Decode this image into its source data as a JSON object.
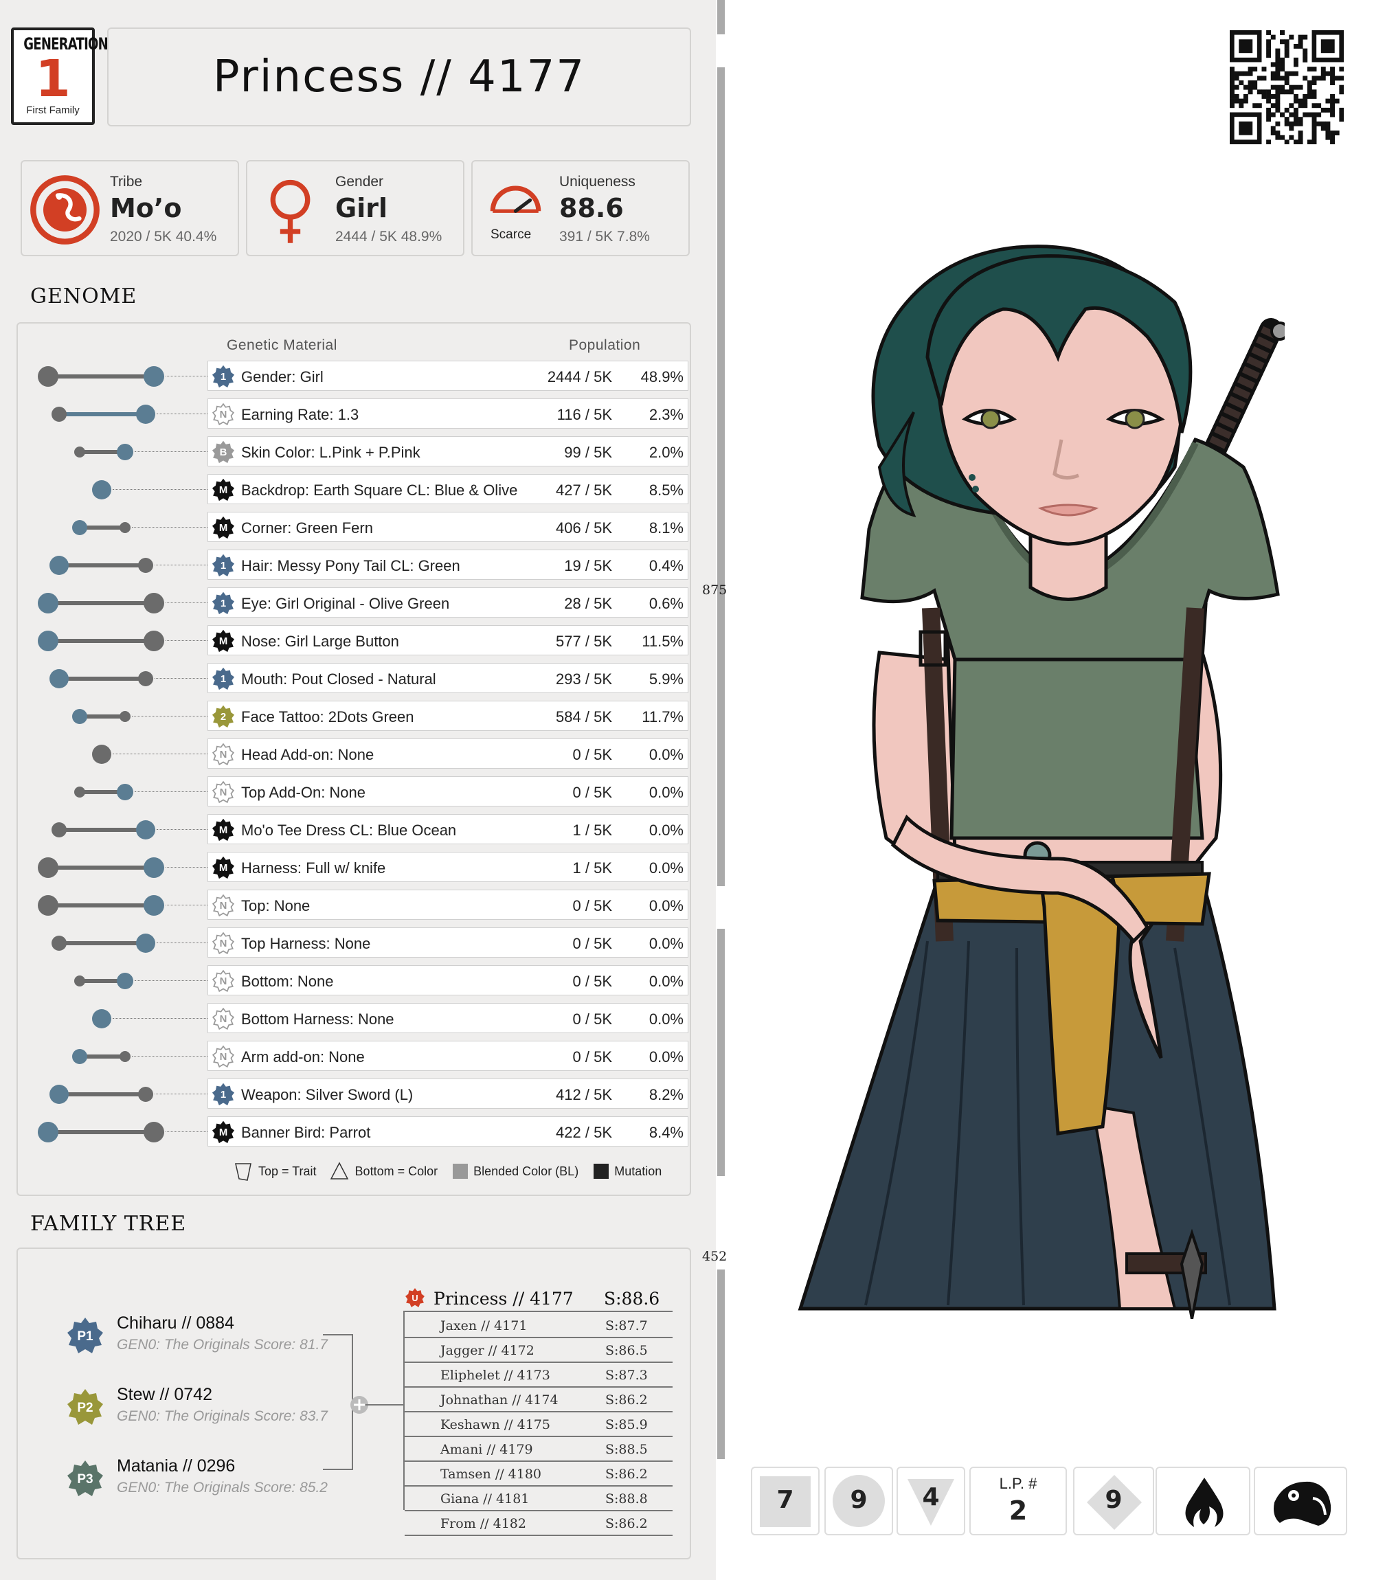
{
  "header": {
    "generation_label": "GENERATION",
    "generation_number": "1",
    "generation_sub": "First Family",
    "title": "Princess // 4177"
  },
  "stats": [
    {
      "label": "Tribe",
      "value": "Mo’o",
      "count": "2020 / 5K  40.4%",
      "icon": "lizard-icon"
    },
    {
      "label": "Gender",
      "value": "Girl",
      "count": "2444 / 5K  48.9%",
      "icon": "female-icon"
    },
    {
      "label": "Uniqueness",
      "value": "88.6",
      "count": "391 / 5K  7.8%",
      "icon": "gauge-icon",
      "icon_caption": "Scarce"
    }
  ],
  "side_numbers": [
    "875",
    "452"
  ],
  "genome": {
    "title": "GENOME",
    "col_material": "Genetic Material",
    "col_population": "Population",
    "rows": [
      {
        "badge": "1",
        "name": "Gender: Girl",
        "pop": "2444 / 5K",
        "pct": "48.9%"
      },
      {
        "badge": "N",
        "name": "Earning Rate: 1.3",
        "pop": "116 / 5K",
        "pct": "2.3%"
      },
      {
        "badge": "B",
        "name": "Skin Color: L.Pink + P.Pink",
        "pop": "99 / 5K",
        "pct": "2.0%"
      },
      {
        "badge": "M",
        "name": "Backdrop: Earth Square CL: Blue & Olive",
        "pop": "427 / 5K",
        "pct": "8.5%"
      },
      {
        "badge": "M",
        "name": "Corner: Green Fern",
        "pop": "406 / 5K",
        "pct": "8.1%"
      },
      {
        "badge": "1",
        "name": "Hair: Messy Pony Tail CL: Green",
        "pop": "19 / 5K",
        "pct": "0.4%"
      },
      {
        "badge": "1",
        "name": "Eye: Girl Original - Olive Green",
        "pop": "28 / 5K",
        "pct": "0.6%"
      },
      {
        "badge": "M",
        "name": "Nose: Girl Large Button",
        "pop": "577 / 5K",
        "pct": "11.5%"
      },
      {
        "badge": "1",
        "name": "Mouth: Pout Closed - Natural",
        "pop": "293 / 5K",
        "pct": "5.9%"
      },
      {
        "badge": "2",
        "name": "Face Tattoo: 2Dots Green",
        "pop": "584 / 5K",
        "pct": "11.7%"
      },
      {
        "badge": "N",
        "name": "Head Add-on:  None",
        "pop": "0 / 5K",
        "pct": "0.0%"
      },
      {
        "badge": "N",
        "name": "Top Add-On:  None",
        "pop": "0 / 5K",
        "pct": "0.0%"
      },
      {
        "badge": "M",
        "name": "Mo'o Tee Dress CL: Blue Ocean",
        "pop": "1 / 5K",
        "pct": "0.0%"
      },
      {
        "badge": "M",
        "name": "Harness: Full w/ knife",
        "pop": "1 / 5K",
        "pct": "0.0%"
      },
      {
        "badge": "N",
        "name": "Top: None",
        "pop": "0 / 5K",
        "pct": "0.0%"
      },
      {
        "badge": "N",
        "name": "Top Harness: None",
        "pop": "0 / 5K",
        "pct": "0.0%"
      },
      {
        "badge": "N",
        "name": "Bottom: None",
        "pop": "0 / 5K",
        "pct": "0.0%"
      },
      {
        "badge": "N",
        "name": "Bottom Harness: None",
        "pop": "0 / 5K",
        "pct": "0.0%"
      },
      {
        "badge": "N",
        "name": "Arm add-on: None",
        "pop": "0 / 5K",
        "pct": "0.0%"
      },
      {
        "badge": "1",
        "name": "Weapon: Silver Sword (L)",
        "pop": "412 / 5K",
        "pct": "8.2%"
      },
      {
        "badge": "M",
        "name": "Banner Bird:  Parrot",
        "pop": "422 / 5K",
        "pct": "8.4%"
      }
    ],
    "legend": {
      "trait": "Top = Trait",
      "color": "Bottom = Color",
      "blended": "Blended Color (BL)",
      "mutation": "Mutation"
    }
  },
  "family": {
    "title": "FAMILY TREE",
    "parents": [
      {
        "badge": "P1",
        "name": "Chiharu  //  0884",
        "score": "GEN0: The Originals Score: 81.7",
        "color": "#4a6a8c"
      },
      {
        "badge": "P2",
        "name": "Stew  //  0742",
        "score": "GEN0: The Originals Score: 83.7",
        "color": "#99973a"
      },
      {
        "badge": "P3",
        "name": "Matania  //  0296",
        "score": "GEN0: The Originals Score: 85.2",
        "color": "#5a7469"
      }
    ],
    "self": {
      "badge": "U",
      "name": "Princess // 4177",
      "score": "S:88.6"
    },
    "siblings": [
      {
        "name": "Jaxen  //  4171",
        "score": "S:87.7"
      },
      {
        "name": "Jagger  //  4172",
        "score": "S:86.5"
      },
      {
        "name": "Eliphelet  //  4173",
        "score": "S:87.3"
      },
      {
        "name": "Johnathan  //  4174",
        "score": "S:86.2"
      },
      {
        "name": "Keshawn  //  4175",
        "score": "S:85.9"
      },
      {
        "name": "Amani  //  4179",
        "score": "S:88.5"
      },
      {
        "name": "Tamsen  //  4180",
        "score": "S:86.2"
      },
      {
        "name": "Giana  //  4181",
        "score": "S:88.8"
      },
      {
        "name": "From  //  4182",
        "score": "S:86.2"
      }
    ]
  },
  "bottom_tiles": [
    {
      "value": "7",
      "shape": "square"
    },
    {
      "value": "9",
      "shape": "circle"
    },
    {
      "value": "4",
      "shape": "triangle"
    },
    {
      "label": "L.P. #",
      "value": "2",
      "shape": "text"
    },
    {
      "value": "9",
      "shape": "diamond"
    },
    {
      "icon": "flame-icon"
    },
    {
      "icon": "parrot-icon"
    }
  ],
  "colors": {
    "accent_red": "#d23f24",
    "badge_blue": "#4a6a8c",
    "slider_blue": "#5b7d93",
    "slider_gray": "#6b6b6b",
    "hair": "#1f4f4c",
    "shirt": "#6a7f6a",
    "skirt": "#2f3f4c",
    "sash": "#c79a3a"
  }
}
